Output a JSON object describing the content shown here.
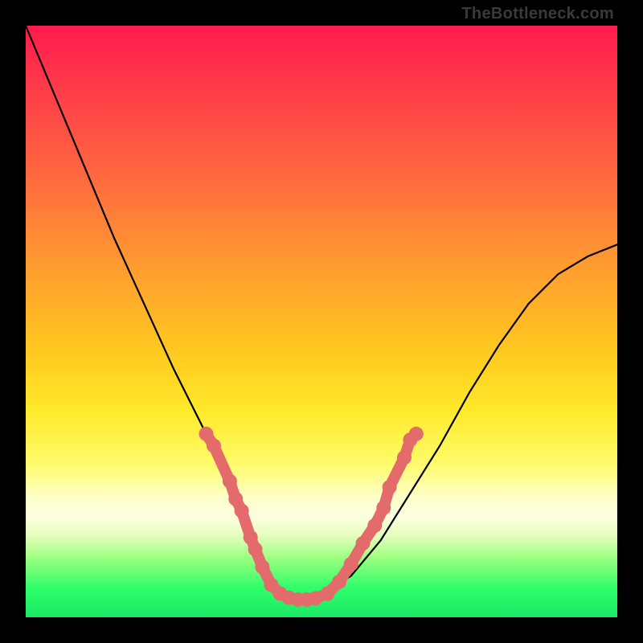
{
  "watermark": "TheBottleneck.com",
  "chart_data": {
    "type": "line",
    "title": "",
    "xlabel": "",
    "ylabel": "",
    "xlim": [
      0,
      100
    ],
    "ylim": [
      0,
      100
    ],
    "grid": false,
    "legend": false,
    "series": [
      {
        "name": "bottleneck-curve",
        "x": [
          0,
          5,
          10,
          15,
          20,
          25,
          30,
          33,
          36,
          38,
          40,
          42,
          44,
          46,
          48,
          50,
          55,
          60,
          65,
          70,
          75,
          80,
          85,
          90,
          95,
          100
        ],
        "y": [
          100,
          88,
          76,
          64,
          53,
          42,
          32,
          26,
          20,
          15,
          10,
          6,
          4,
          3,
          3,
          4,
          7,
          13,
          21,
          29,
          38,
          46,
          53,
          58,
          61,
          63
        ]
      }
    ],
    "markers": [
      {
        "x": 30.5,
        "y": 31
      },
      {
        "x": 31.8,
        "y": 29
      },
      {
        "x": 34.5,
        "y": 23
      },
      {
        "x": 35.5,
        "y": 20
      },
      {
        "x": 36.5,
        "y": 18
      },
      {
        "x": 38.0,
        "y": 13.5
      },
      {
        "x": 38.8,
        "y": 11.5
      },
      {
        "x": 40.0,
        "y": 8.5
      },
      {
        "x": 41.5,
        "y": 5.5
      },
      {
        "x": 43.0,
        "y": 4.0
      },
      {
        "x": 44.5,
        "y": 3.3
      },
      {
        "x": 46.0,
        "y": 3.0
      },
      {
        "x": 47.5,
        "y": 3.0
      },
      {
        "x": 49.0,
        "y": 3.2
      },
      {
        "x": 51.0,
        "y": 4.0
      },
      {
        "x": 53.0,
        "y": 6.0
      },
      {
        "x": 55.0,
        "y": 9.0
      },
      {
        "x": 57.0,
        "y": 12.5
      },
      {
        "x": 59.0,
        "y": 15.5
      },
      {
        "x": 60.5,
        "y": 18.5
      },
      {
        "x": 61.5,
        "y": 22
      },
      {
        "x": 64.0,
        "y": 27
      },
      {
        "x": 65.0,
        "y": 30
      },
      {
        "x": 66.0,
        "y": 31
      }
    ],
    "background_gradient": {
      "direction": "vertical",
      "stops": [
        {
          "pos": 0.0,
          "color": "#ff1a4d"
        },
        {
          "pos": 0.4,
          "color": "#ff9a30"
        },
        {
          "pos": 0.65,
          "color": "#ffe92a"
        },
        {
          "pos": 0.83,
          "color": "#fbffe0"
        },
        {
          "pos": 1.0,
          "color": "#19e865"
        }
      ]
    }
  }
}
